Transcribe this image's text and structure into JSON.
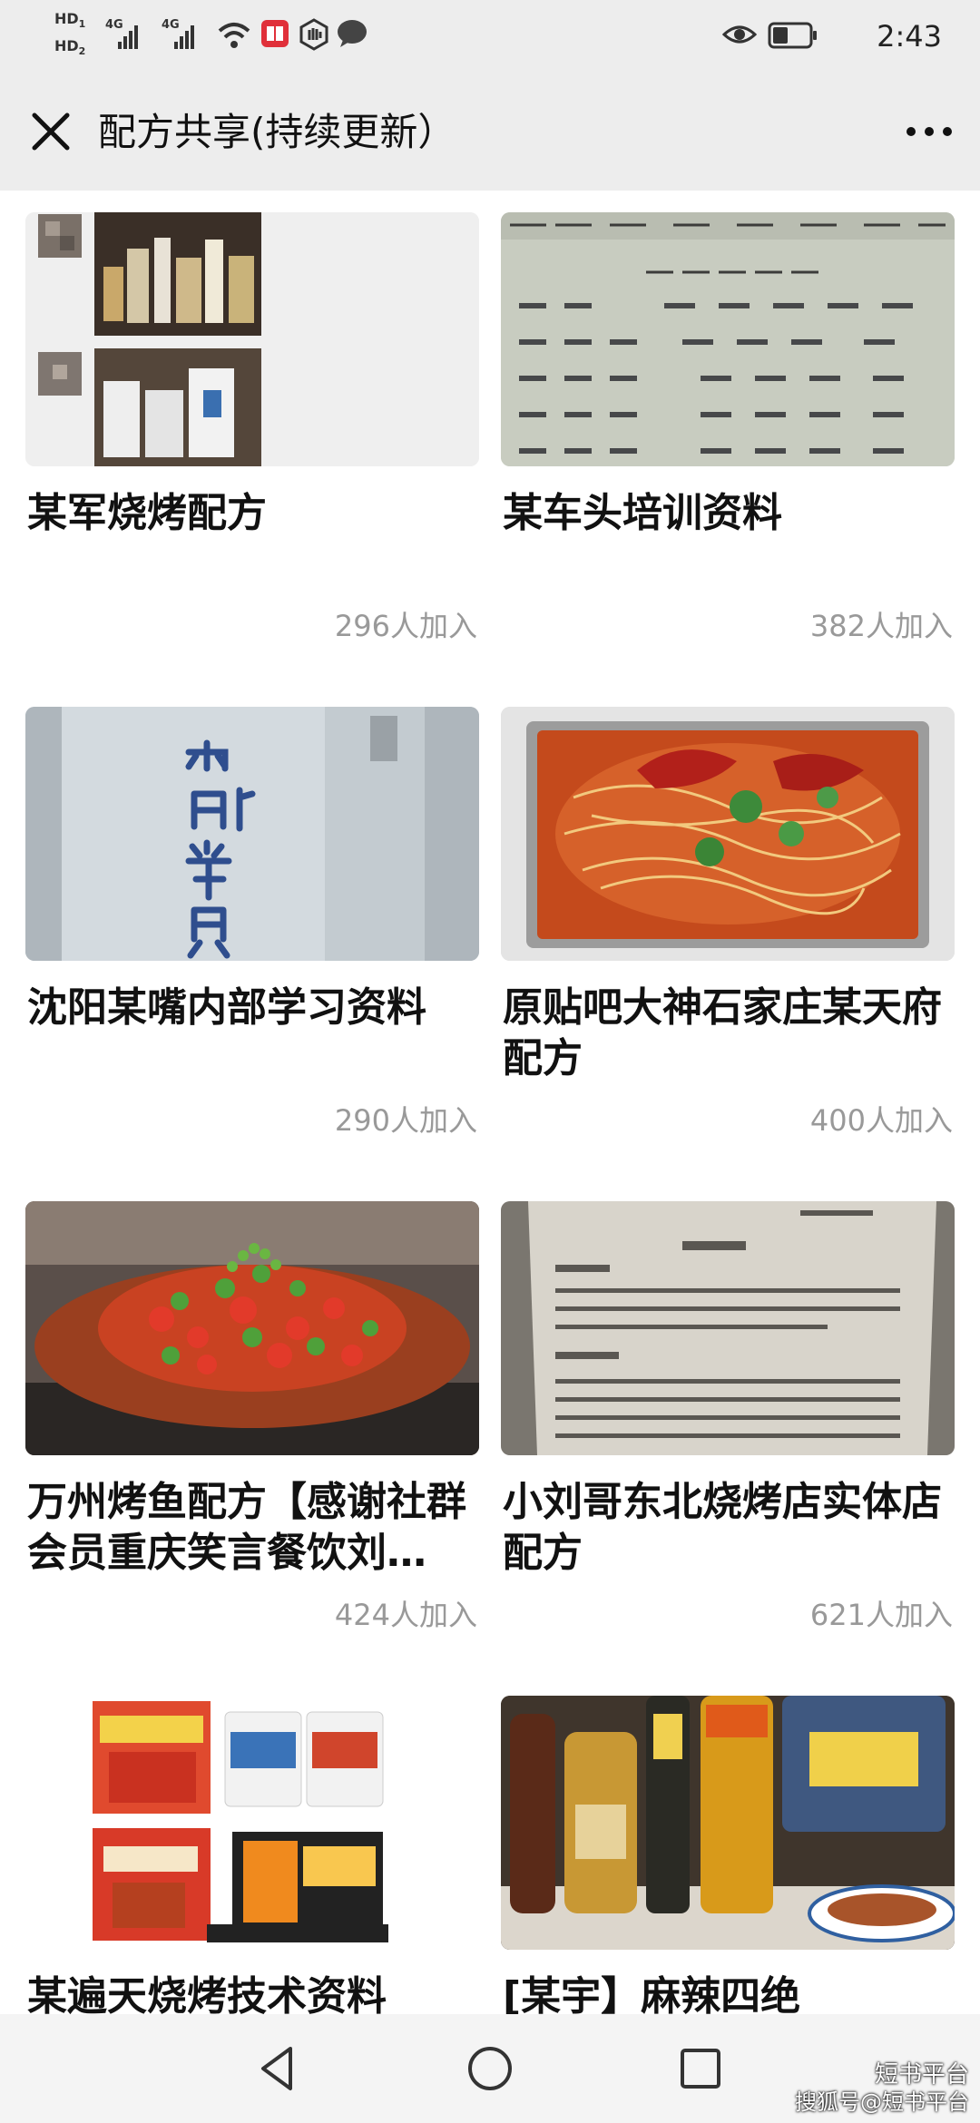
{
  "status": {
    "time": "2:43",
    "hd1": "HD",
    "hd2": "HD",
    "net1": "4G",
    "net2": "4G"
  },
  "header": {
    "title": "配方共享(持续更新）"
  },
  "cards": [
    {
      "name": "某军烧烤配方",
      "count": "296人加入"
    },
    {
      "name": "某车头培训资料",
      "count": "382人加入"
    },
    {
      "name": "沈阳某嘴内部学习资料",
      "count": "290人加入"
    },
    {
      "name": "原贴吧大神石家庄某天府配方",
      "count": "400人加入"
    },
    {
      "name": "万州烤鱼配方【感谢社群会员重庆笑言餐饮刘…",
      "count": "424人加入"
    },
    {
      "name": "小刘哥东北烧烤店实体店配方",
      "count": "621人加入"
    },
    {
      "name": "某遍天烧烤技术资料",
      "count": ""
    },
    {
      "name": "[某宇】麻辣四绝",
      "count": ""
    }
  ],
  "watermark": {
    "line1": "短书平台",
    "line2": "搜狐号@短书平台"
  },
  "colors": {
    "header_bg": "#ededed",
    "muted_text": "#999999"
  },
  "icons": [
    "close-icon",
    "more-icon",
    "back-icon",
    "home-icon",
    "recents-icon",
    "wifi-icon",
    "eye-icon",
    "battery-icon"
  ]
}
